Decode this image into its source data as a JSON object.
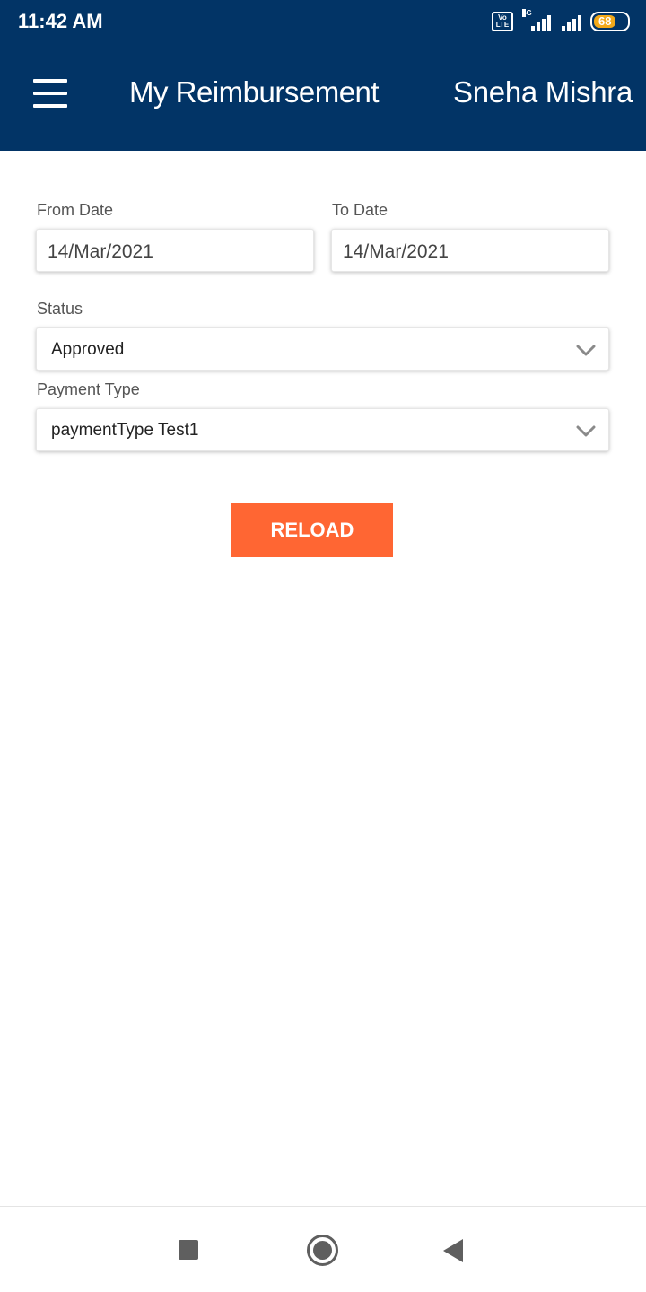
{
  "status_bar": {
    "time": "11:42 AM",
    "volte": "Vo LTE",
    "network": "4G",
    "battery": "68"
  },
  "header": {
    "title": "My Reimbursement",
    "user_name": "Sneha Mishra"
  },
  "form": {
    "from_date": {
      "label": "From Date",
      "value": "14/Mar/2021"
    },
    "to_date": {
      "label": "To Date",
      "value": "14/Mar/2021"
    },
    "status": {
      "label": "Status",
      "value": "Approved"
    },
    "payment_type": {
      "label": "Payment Type",
      "value": "paymentType Test1"
    }
  },
  "actions": {
    "reload_label": "RELOAD"
  },
  "colors": {
    "header_bg": "#023466",
    "accent": "#ff6633",
    "battery": "#f2a91a"
  },
  "icons": [
    "hamburger-menu-icon",
    "volte-icon",
    "signal-icon",
    "battery-icon",
    "chevron-down-icon",
    "recents-icon",
    "home-icon",
    "back-icon"
  ]
}
